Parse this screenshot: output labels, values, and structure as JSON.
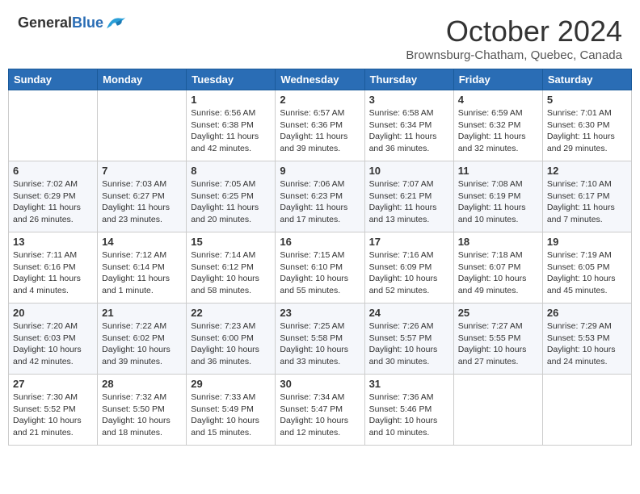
{
  "header": {
    "logo_general": "General",
    "logo_blue": "Blue",
    "month_title": "October 2024",
    "subtitle": "Brownsburg-Chatham, Quebec, Canada"
  },
  "days_of_week": [
    "Sunday",
    "Monday",
    "Tuesday",
    "Wednesday",
    "Thursday",
    "Friday",
    "Saturday"
  ],
  "weeks": [
    [
      {
        "day": "",
        "info": ""
      },
      {
        "day": "",
        "info": ""
      },
      {
        "day": "1",
        "info": "Sunrise: 6:56 AM\nSunset: 6:38 PM\nDaylight: 11 hours and 42 minutes."
      },
      {
        "day": "2",
        "info": "Sunrise: 6:57 AM\nSunset: 6:36 PM\nDaylight: 11 hours and 39 minutes."
      },
      {
        "day": "3",
        "info": "Sunrise: 6:58 AM\nSunset: 6:34 PM\nDaylight: 11 hours and 36 minutes."
      },
      {
        "day": "4",
        "info": "Sunrise: 6:59 AM\nSunset: 6:32 PM\nDaylight: 11 hours and 32 minutes."
      },
      {
        "day": "5",
        "info": "Sunrise: 7:01 AM\nSunset: 6:30 PM\nDaylight: 11 hours and 29 minutes."
      }
    ],
    [
      {
        "day": "6",
        "info": "Sunrise: 7:02 AM\nSunset: 6:29 PM\nDaylight: 11 hours and 26 minutes."
      },
      {
        "day": "7",
        "info": "Sunrise: 7:03 AM\nSunset: 6:27 PM\nDaylight: 11 hours and 23 minutes."
      },
      {
        "day": "8",
        "info": "Sunrise: 7:05 AM\nSunset: 6:25 PM\nDaylight: 11 hours and 20 minutes."
      },
      {
        "day": "9",
        "info": "Sunrise: 7:06 AM\nSunset: 6:23 PM\nDaylight: 11 hours and 17 minutes."
      },
      {
        "day": "10",
        "info": "Sunrise: 7:07 AM\nSunset: 6:21 PM\nDaylight: 11 hours and 13 minutes."
      },
      {
        "day": "11",
        "info": "Sunrise: 7:08 AM\nSunset: 6:19 PM\nDaylight: 11 hours and 10 minutes."
      },
      {
        "day": "12",
        "info": "Sunrise: 7:10 AM\nSunset: 6:17 PM\nDaylight: 11 hours and 7 minutes."
      }
    ],
    [
      {
        "day": "13",
        "info": "Sunrise: 7:11 AM\nSunset: 6:16 PM\nDaylight: 11 hours and 4 minutes."
      },
      {
        "day": "14",
        "info": "Sunrise: 7:12 AM\nSunset: 6:14 PM\nDaylight: 11 hours and 1 minute."
      },
      {
        "day": "15",
        "info": "Sunrise: 7:14 AM\nSunset: 6:12 PM\nDaylight: 10 hours and 58 minutes."
      },
      {
        "day": "16",
        "info": "Sunrise: 7:15 AM\nSunset: 6:10 PM\nDaylight: 10 hours and 55 minutes."
      },
      {
        "day": "17",
        "info": "Sunrise: 7:16 AM\nSunset: 6:09 PM\nDaylight: 10 hours and 52 minutes."
      },
      {
        "day": "18",
        "info": "Sunrise: 7:18 AM\nSunset: 6:07 PM\nDaylight: 10 hours and 49 minutes."
      },
      {
        "day": "19",
        "info": "Sunrise: 7:19 AM\nSunset: 6:05 PM\nDaylight: 10 hours and 45 minutes."
      }
    ],
    [
      {
        "day": "20",
        "info": "Sunrise: 7:20 AM\nSunset: 6:03 PM\nDaylight: 10 hours and 42 minutes."
      },
      {
        "day": "21",
        "info": "Sunrise: 7:22 AM\nSunset: 6:02 PM\nDaylight: 10 hours and 39 minutes."
      },
      {
        "day": "22",
        "info": "Sunrise: 7:23 AM\nSunset: 6:00 PM\nDaylight: 10 hours and 36 minutes."
      },
      {
        "day": "23",
        "info": "Sunrise: 7:25 AM\nSunset: 5:58 PM\nDaylight: 10 hours and 33 minutes."
      },
      {
        "day": "24",
        "info": "Sunrise: 7:26 AM\nSunset: 5:57 PM\nDaylight: 10 hours and 30 minutes."
      },
      {
        "day": "25",
        "info": "Sunrise: 7:27 AM\nSunset: 5:55 PM\nDaylight: 10 hours and 27 minutes."
      },
      {
        "day": "26",
        "info": "Sunrise: 7:29 AM\nSunset: 5:53 PM\nDaylight: 10 hours and 24 minutes."
      }
    ],
    [
      {
        "day": "27",
        "info": "Sunrise: 7:30 AM\nSunset: 5:52 PM\nDaylight: 10 hours and 21 minutes."
      },
      {
        "day": "28",
        "info": "Sunrise: 7:32 AM\nSunset: 5:50 PM\nDaylight: 10 hours and 18 minutes."
      },
      {
        "day": "29",
        "info": "Sunrise: 7:33 AM\nSunset: 5:49 PM\nDaylight: 10 hours and 15 minutes."
      },
      {
        "day": "30",
        "info": "Sunrise: 7:34 AM\nSunset: 5:47 PM\nDaylight: 10 hours and 12 minutes."
      },
      {
        "day": "31",
        "info": "Sunrise: 7:36 AM\nSunset: 5:46 PM\nDaylight: 10 hours and 10 minutes."
      },
      {
        "day": "",
        "info": ""
      },
      {
        "day": "",
        "info": ""
      }
    ]
  ]
}
